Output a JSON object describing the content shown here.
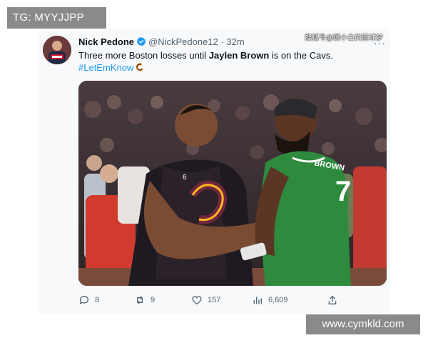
{
  "overlay": {
    "tg_label": "TG: MYYJJPP",
    "website": "www.cymkld.com",
    "source_watermark": "搜狐号@顾小白的篮球梦"
  },
  "tweet": {
    "author": {
      "name": "Nick Pedone",
      "handle": "@NickPedone12",
      "separator": "·",
      "time": "32m",
      "verified": true,
      "avatar_icon": "profile-avatar"
    },
    "text": {
      "part1": "Three more Boston losses until ",
      "bold": "Jaylen Brown",
      "part2": " is on the Cavs."
    },
    "hashtag": "#LetEmKnow",
    "more_icon": "more-dots-icon",
    "photo": {
      "left_jersey_number": "6",
      "right_jersey_number": "7",
      "right_jersey_name": "BROWN"
    },
    "actions": {
      "reply": {
        "icon": "reply-icon",
        "count": "8"
      },
      "retweet": {
        "icon": "retweet-icon",
        "count": "9"
      },
      "like": {
        "icon": "like-icon",
        "count": "157"
      },
      "views": {
        "icon": "views-icon",
        "count": "6,609"
      },
      "share": {
        "icon": "share-icon"
      }
    }
  },
  "colors": {
    "accent": "#1d9bf0",
    "muted": "#536471",
    "cavs_wine": "#6f263d",
    "cavs_gold": "#ffb81c",
    "celtics_green": "#2e8b3d"
  }
}
